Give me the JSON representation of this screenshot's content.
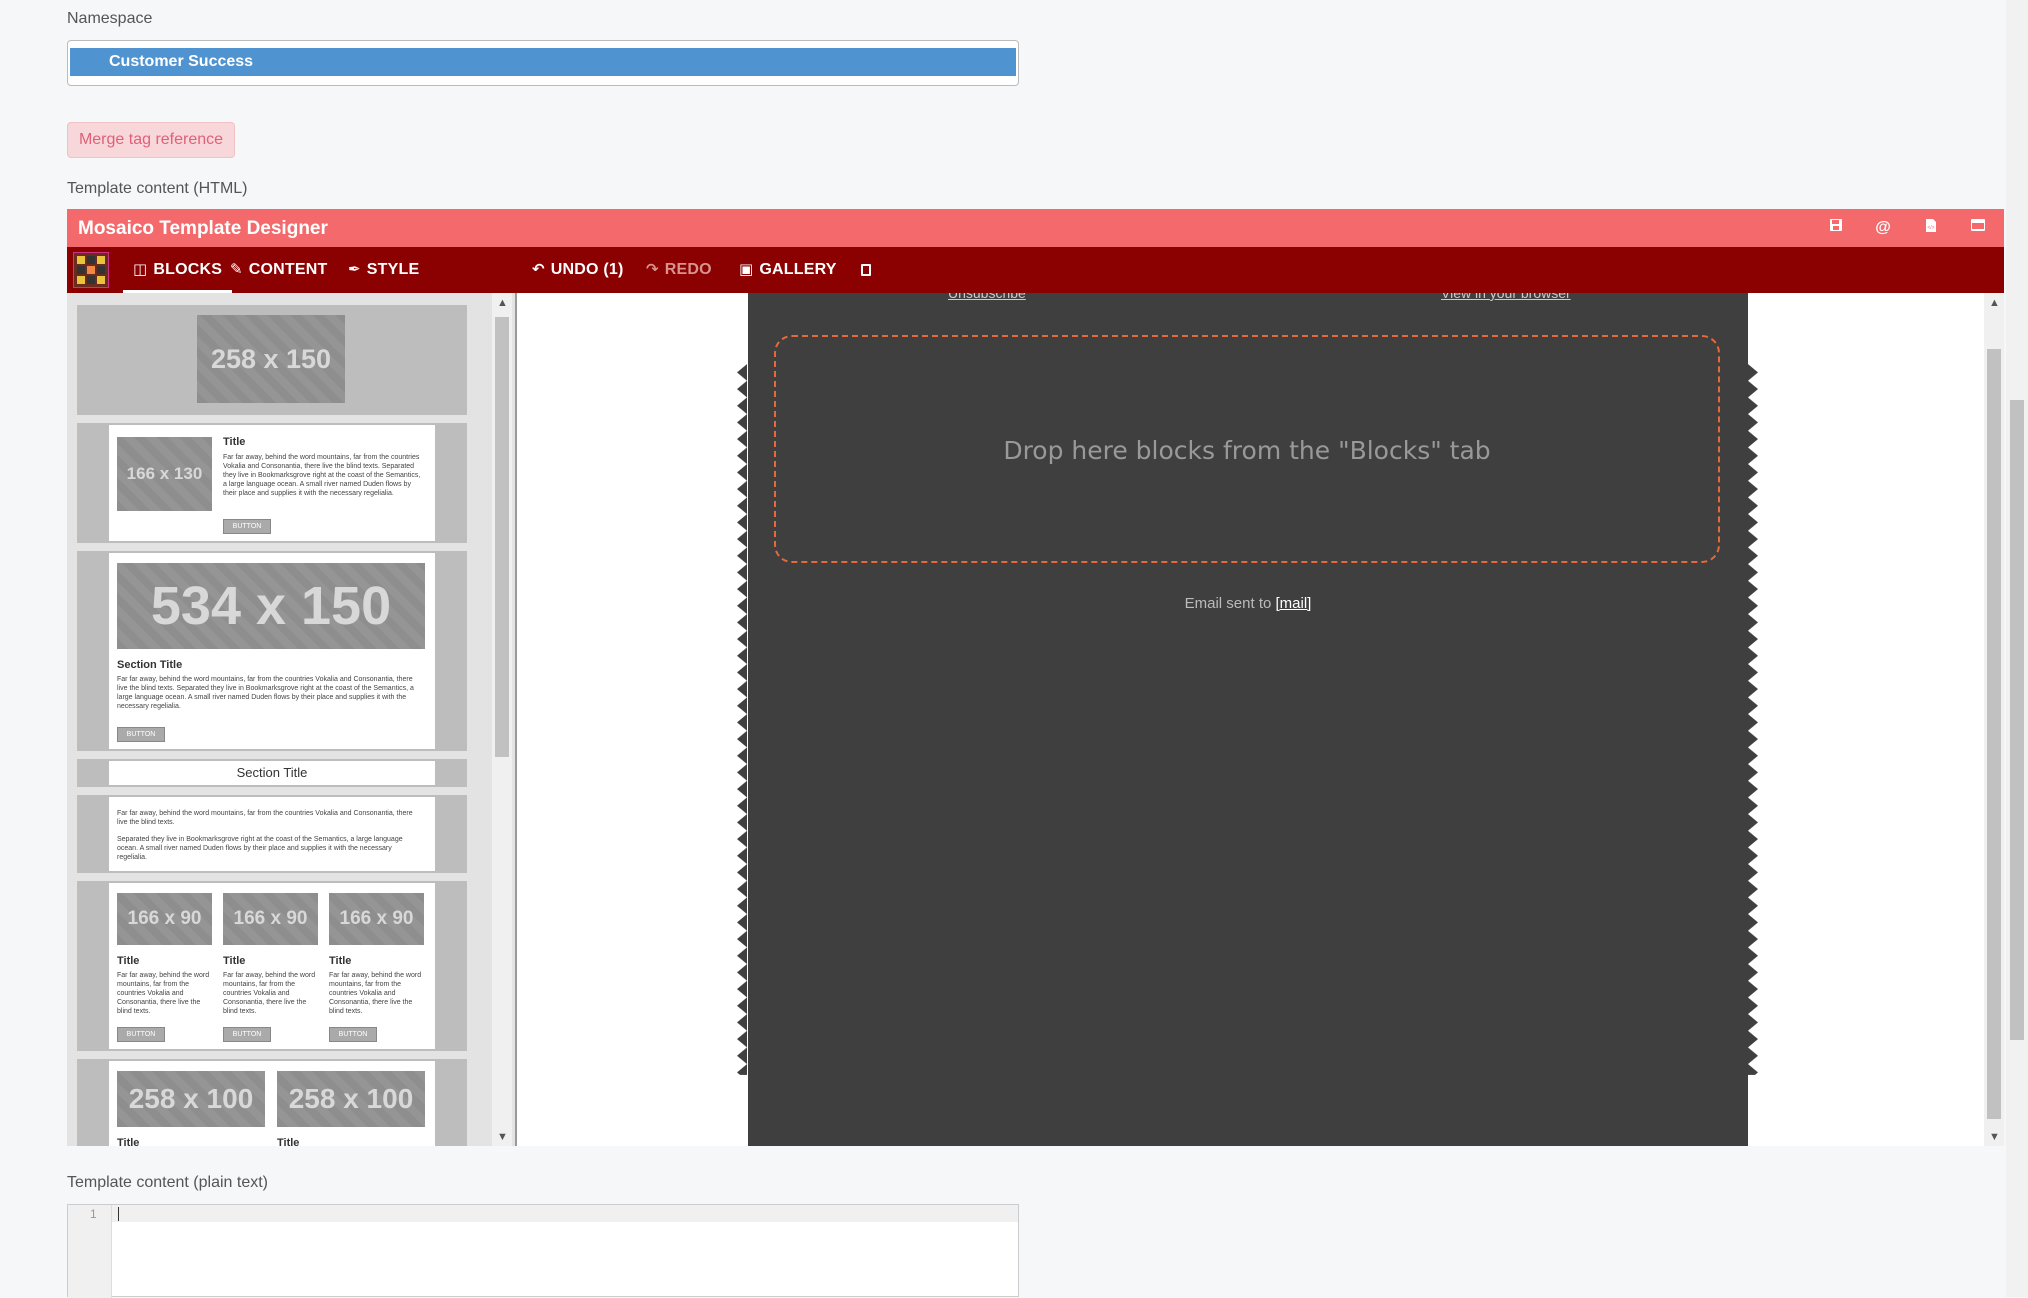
{
  "namespace": {
    "label": "Namespace",
    "selected": "Customer Success"
  },
  "merge_tag_button": "Merge tag reference",
  "html_label": "Template content (HTML)",
  "designer": {
    "title": "Mosaico Template Designer",
    "tabs": {
      "blocks": "BLOCKS",
      "content": "CONTENT",
      "style": "STYLE"
    },
    "undo": "UNDO (1)",
    "redo": "REDO",
    "gallery": "GALLERY",
    "header_icons": [
      "save-icon",
      "at-icon",
      "html-file-icon",
      "window-icon"
    ]
  },
  "blocks": {
    "ph_258x150": "258 x 150",
    "ph_166x130": "166 x 130",
    "ph_534x150": "534 x 150",
    "ph_166x90": "166 x 90",
    "ph_258x100": "258 x 100",
    "title": "Title",
    "section_title": "Section Title",
    "button": "BUTTON",
    "text_short": "Far far away, behind the word mountains, far from the countries Vokalia and Consonantia, there live the blind texts. Separated they live in Bookmarksgrove right at the coast of the Semantics, a large language ocean. A small river named Duden flows by their place and supplies it with the necessary regelialia.",
    "text_par1": "Far far away, behind the word mountains, far from the countries Vokalia and Consonantia, there live the blind texts.",
    "text_par2": "Separated they live in Bookmarksgrove right at the coast of the Semantics, a large language ocean. A small river named Duden flows by their place and supplies it with the necessary regelialia.",
    "text_col": "Far far away, behind the word mountains, far from the countries Vokalia and Consonantia, there live the blind texts."
  },
  "canvas": {
    "unsubscribe": "Unsubscribe",
    "view_browser": "View in your browser",
    "drop_text": "Drop here blocks from the \"Blocks\" tab",
    "email_sent": "Email sent to",
    "mail_tag": "[mail]"
  },
  "plain_label": "Template content (plain text)",
  "editor": {
    "line_number": "1"
  }
}
